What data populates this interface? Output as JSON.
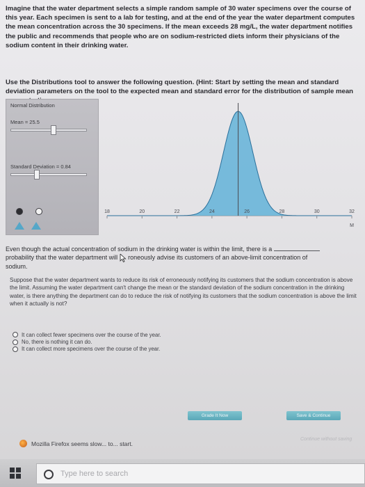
{
  "intro_text": "Imagine that the water department selects a simple random sample of 30 water specimens over the course of this year. Each specimen is sent to a lab for testing, and at the end of the year the water department computes the mean concentration across the 30 specimens. If the mean exceeds 28 mg/L, the water department notifies the public and recommends that people who are on sodium-restricted diets inform their physicians of the sodium content in their drinking water.",
  "hint_text": "Use the Distributions tool to answer the following question. (Hint: Start by setting the mean and standard deviation parameters on the tool to the expected mean and standard error for the distribution of sample mean concentrations.",
  "tool": {
    "title": "Normal Distribution",
    "mean_label": "Mean = 25.5",
    "mean_fraction": 0.56,
    "sd_label": "Standard Deviation = 0.84",
    "sd_fraction": 0.32
  },
  "chart_data": {
    "type": "area",
    "title": "",
    "xlabel": "M",
    "ylabel": "",
    "distribution": "normal",
    "mean": 25.5,
    "sd": 0.84,
    "xlim": [
      18,
      32
    ],
    "xticks": [
      18,
      20,
      22,
      24,
      26,
      28,
      30,
      32
    ],
    "marker_x": 25.5,
    "fill_color": "#63b3d8",
    "line_color": "#2a6f9a"
  },
  "question1": {
    "before": "Even though the actual concentration of sodium in the drinking water is within the limit, there is a",
    "after_a": "probability that the water department will",
    "after_b": "roneously advise its customers of an above-limit concentration of",
    "after_c": "sodium."
  },
  "question2": "Suppose that the water department wants to reduce its risk of erroneously notifying its customers that the sodium concentration is above the limit. Assuming the water department can't change the mean or the standard deviation of the sodium concentration in the drinking water, is there anything the department can do to reduce the risk of notifying its customers that the sodium concentration is above the limit when it actually is not?",
  "options": [
    "It can collect fewer specimens over the course of the year.",
    "No, there is nothing it can do.",
    "It can collect more specimens over the course of the year."
  ],
  "buttons": {
    "hint": "Grade It Now",
    "save": "Save & Continue"
  },
  "watermark": "Continue without saving",
  "notice": "Mozilla Firefox seems slow... to... start.",
  "taskbar": {
    "search_placeholder": "Type here to search"
  }
}
